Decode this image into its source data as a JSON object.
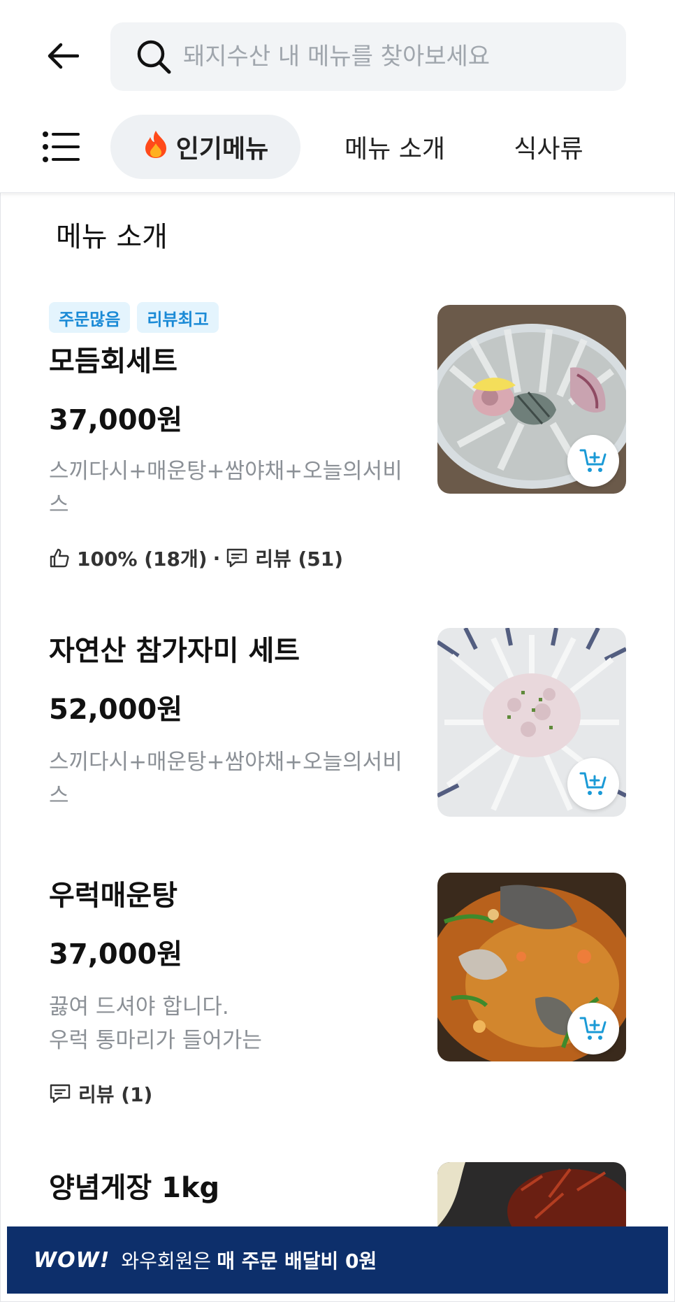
{
  "search": {
    "placeholder": "돼지수산 내 메뉴를 찾아보세요"
  },
  "categories": {
    "tabs": [
      {
        "label": "인기메뉴",
        "icon": "fire-icon"
      },
      {
        "label": "메뉴 소개"
      },
      {
        "label": "식사류"
      }
    ]
  },
  "section": {
    "title": "메뉴 소개"
  },
  "items": [
    {
      "badges": [
        "주문많음",
        "리뷰최고"
      ],
      "name": "모듬회세트",
      "price": "37,000원",
      "desc_line1": "스끼다시+매운탕+쌈야채+오늘의서비",
      "desc_line2": "스",
      "like": "100% (18개)",
      "review": "리뷰 (51)"
    },
    {
      "name": "자연산 참가자미 세트",
      "price": "52,000원",
      "desc_line1": "스끼다시+매운탕+쌈야채+오늘의서비",
      "desc_line2": "스"
    },
    {
      "name": "우럭매운탕",
      "price": "37,000원",
      "desc_line1": "끓여 드셔야 합니다.",
      "desc_line2": "우럭 통마리가 들어가는",
      "review": "리뷰 (1)"
    },
    {
      "name": "양념게장 1kg"
    }
  ],
  "banner": {
    "logo": "WOW!",
    "text": "와우회원은",
    "highlight": "매 주문 배달비 0원"
  },
  "colors": {
    "accent": "#1a8ad6",
    "banner_bg": "#0d2f6b",
    "badge_bg": "#e4f4fd"
  }
}
